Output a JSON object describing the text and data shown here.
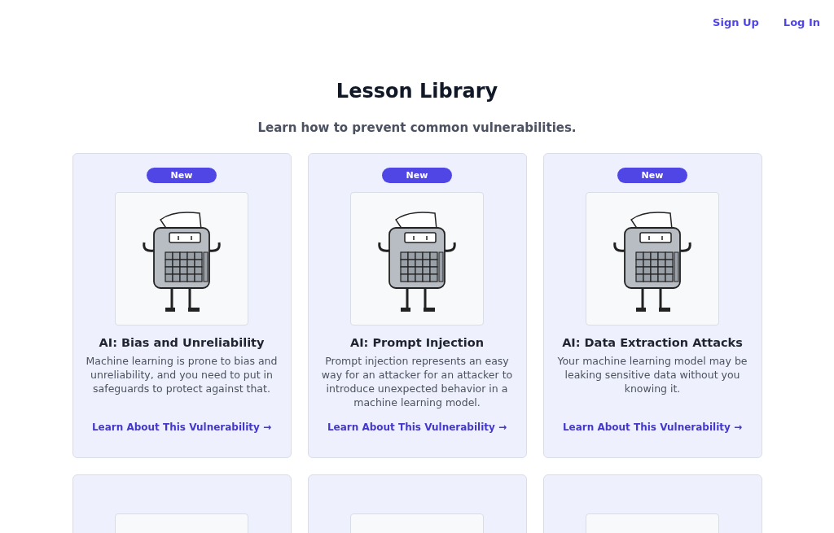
{
  "nav": {
    "links": [
      "Sign Up",
      "Log In"
    ]
  },
  "header": {
    "title": "Lesson Library",
    "subtitle": "Learn how to prevent common vulnerabilities."
  },
  "cards": [
    {
      "kind": "lesson",
      "badge": "New",
      "title": "AI: Bias and Unreliability",
      "description": "Machine learning is prone to bias and unreliability, and you need to put in safeguards to protect against that.",
      "link": "Learn About This Vulnerability →"
    },
    {
      "kind": "lesson",
      "badge": "New",
      "title": "AI: Prompt Injection",
      "description": "Prompt injection represents an easy way for an attacker for an attacker to introduce unexpected behavior in a machine learning model.",
      "link": "Learn About This Vulnerability →"
    },
    {
      "kind": "lesson",
      "badge": "New",
      "title": "AI: Data Extraction Attacks",
      "description": "Your machine learning model may be leaking sensitive data without you knowing it.",
      "link": "Learn About This Vulnerability →"
    },
    {
      "kind": "partial"
    },
    {
      "kind": "partial"
    },
    {
      "kind": "partial"
    }
  ]
}
